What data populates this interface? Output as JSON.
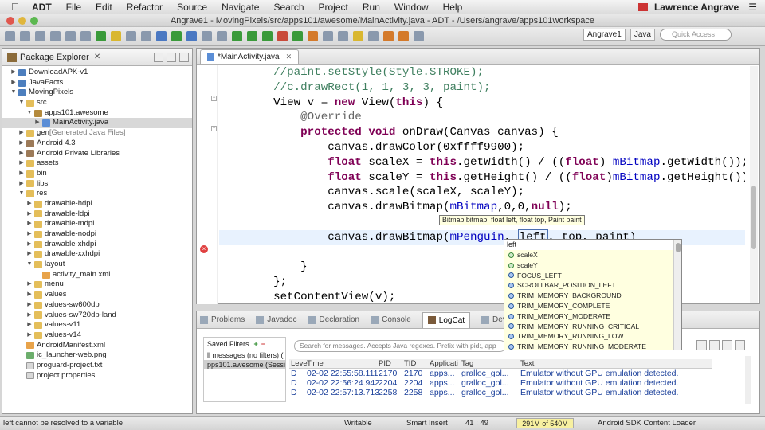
{
  "menubar": {
    "items": [
      "ADT",
      "File",
      "Edit",
      "Refactor",
      "Source",
      "Navigate",
      "Search",
      "Project",
      "Run",
      "Window",
      "Help"
    ],
    "user": "Lawrence Angrave"
  },
  "window": {
    "title": "Angrave1 - MovingPixels/src/apps101/awesome/MainActivity.java - ADT - /Users/angrave/apps101workspace"
  },
  "toolbar": {
    "perspectives": [
      "Angrave1",
      "Java"
    ],
    "quick_access_placeholder": "Quick Access"
  },
  "package_explorer": {
    "title": "Package Explorer",
    "nodes": [
      {
        "label": "DownloadAPK-v1",
        "icon": "proj"
      },
      {
        "label": "JavaFacts",
        "icon": "proj"
      },
      {
        "label": "MovingPixels",
        "icon": "proj"
      },
      {
        "label": "src",
        "icon": "folder"
      },
      {
        "label": "apps101.awesome",
        "icon": "pkg"
      },
      {
        "label": "MainActivity.java",
        "icon": "java",
        "selected": true
      },
      {
        "label": "gen",
        "icon": "folder",
        "decoration": "[Generated Java Files]"
      },
      {
        "label": "Android 4.3",
        "icon": "lib"
      },
      {
        "label": "Android Private Libraries",
        "icon": "lib"
      },
      {
        "label": "assets",
        "icon": "folder"
      },
      {
        "label": "bin",
        "icon": "folder"
      },
      {
        "label": "libs",
        "icon": "folder"
      },
      {
        "label": "res",
        "icon": "folder"
      },
      {
        "label": "drawable-hdpi",
        "icon": "folder"
      },
      {
        "label": "drawable-ldpi",
        "icon": "folder"
      },
      {
        "label": "drawable-mdpi",
        "icon": "folder"
      },
      {
        "label": "drawable-nodpi",
        "icon": "folder"
      },
      {
        "label": "drawable-xhdpi",
        "icon": "folder"
      },
      {
        "label": "drawable-xxhdpi",
        "icon": "folder"
      },
      {
        "label": "layout",
        "icon": "folder"
      },
      {
        "label": "activity_main.xml",
        "icon": "xml"
      },
      {
        "label": "menu",
        "icon": "folder"
      },
      {
        "label": "values",
        "icon": "folder"
      },
      {
        "label": "values-sw600dp",
        "icon": "folder"
      },
      {
        "label": "values-sw720dp-land",
        "icon": "folder"
      },
      {
        "label": "values-v11",
        "icon": "folder"
      },
      {
        "label": "values-v14",
        "icon": "folder"
      },
      {
        "label": "AndroidManifest.xml",
        "icon": "xml"
      },
      {
        "label": "ic_launcher-web.png",
        "icon": "img"
      },
      {
        "label": "proguard-project.txt",
        "icon": "file"
      },
      {
        "label": "project.properties",
        "icon": "file"
      }
    ]
  },
  "editor": {
    "tab": "*MainActivity.java",
    "code_lines": [
      "        //paint.setStyle(Style.STROKE);",
      "        //c.drawRect(1, 1, 3, 3, paint);",
      "        View v = new View(this) {",
      "            @Override",
      "            protected void onDraw(Canvas canvas) {",
      "                canvas.drawColor(0xffff9900);",
      "                float scaleX = this.getWidth() / ((float) mBitmap.getWidth());",
      "                float scaleY = this.getHeight() / ((float)mBitmap.getHeight());",
      "                canvas.scale(scaleX, scaleY);",
      "                canvas.drawBitmap(mBitmap,0,0,null);",
      "",
      "                canvas.drawBitmap(mPenguin, left, top, paint)",
      "",
      "            }",
      "        };",
      "        setContentView(v);"
    ],
    "tooltip": "Bitmap bitmap, float left, float top, Paint paint"
  },
  "autocomplete": {
    "header": "left",
    "items": [
      "scaleX",
      "scaleY",
      "FOCUS_LEFT",
      "SCROLLBAR_POSITION_LEFT",
      "TRIM_MEMORY_BACKGROUND",
      "TRIM_MEMORY_COMPLETE",
      "TRIM_MEMORY_MODERATE",
      "TRIM_MEMORY_RUNNING_CRITICAL",
      "TRIM_MEMORY_RUNNING_LOW",
      "TRIM_MEMORY_RUNNING_MODERATE"
    ]
  },
  "bottom": {
    "tabs": [
      "Problems",
      "Javadoc",
      "Declaration",
      "Console",
      "LogCat",
      "Devices"
    ],
    "active_tab": "LogCat",
    "saved_filters": "Saved Filters",
    "filters": [
      "ll messages (no filters) (",
      "pps101.awesome (Sessio"
    ],
    "search_placeholder": "Search for messages. Accepts Java regexes. Prefix with pid:, app",
    "columns": [
      "Leve",
      "Time",
      "PID",
      "TID",
      "Applicati",
      "Tag",
      "Text"
    ],
    "rows": [
      [
        "D",
        "02-02 22:55:58.111",
        "2170",
        "2170",
        "apps...",
        "gralloc_gol...",
        "Emulator without GPU emulation detected."
      ],
      [
        "D",
        "02-02 22:56:24.942",
        "2204",
        "2204",
        "apps...",
        "gralloc_gol...",
        "Emulator without GPU emulation detected."
      ],
      [
        "D",
        "02-02 22:57:13.713",
        "2258",
        "2258",
        "apps...",
        "gralloc_gol...",
        "Emulator without GPU emulation detected."
      ]
    ]
  },
  "status": {
    "message": "left cannot be resolved to a variable",
    "mode": "Writable",
    "insert": "Smart Insert",
    "position": "41 : 49",
    "heap": "291M of 540M",
    "task": "Android SDK Content Loader"
  }
}
